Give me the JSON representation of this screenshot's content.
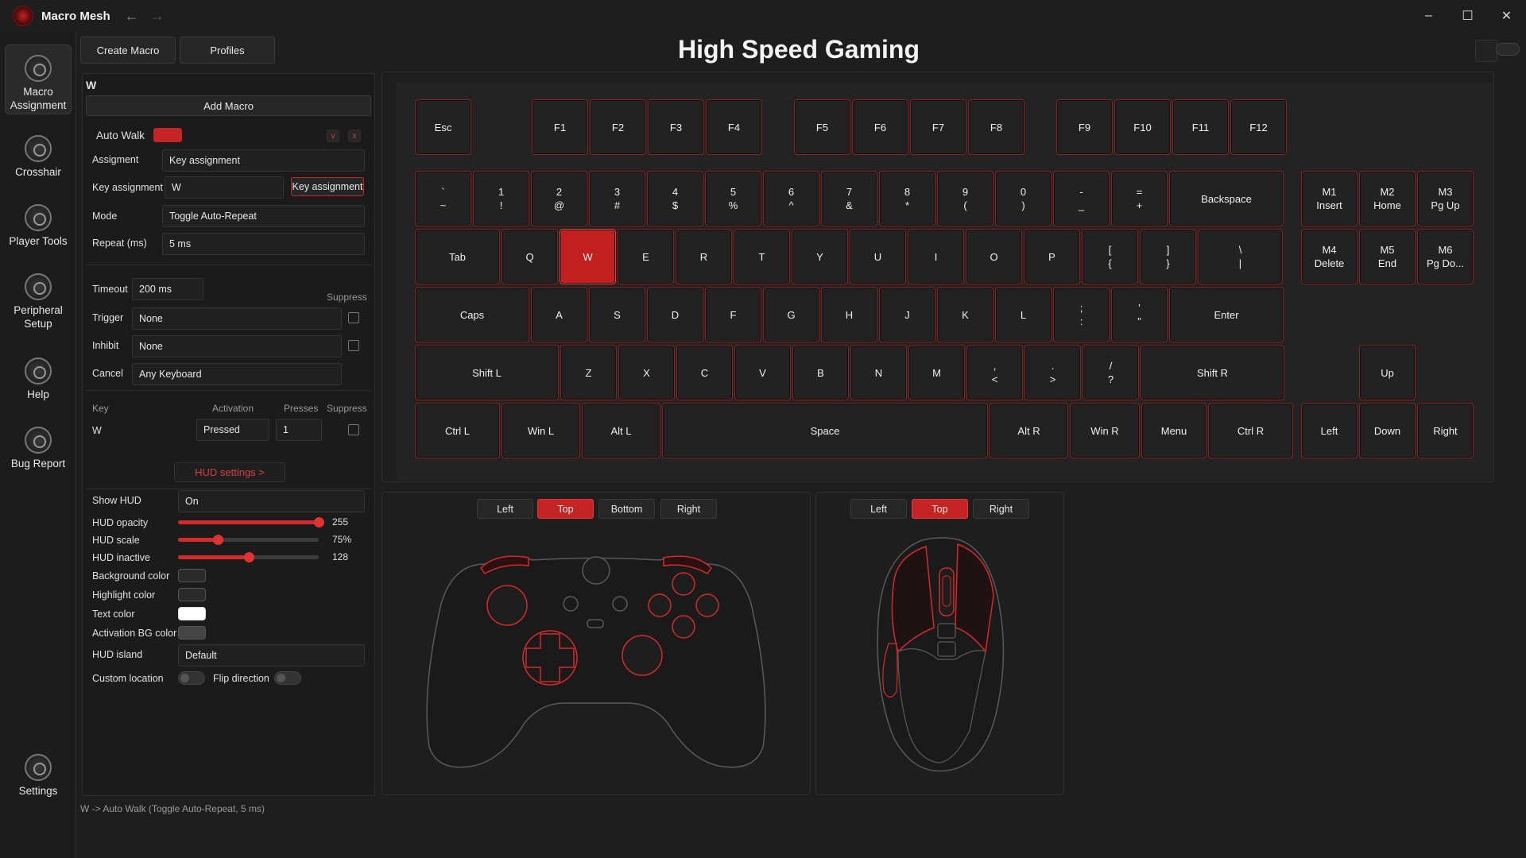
{
  "app": {
    "title": "Macro Mesh"
  },
  "colors": {
    "accent": "#c42424",
    "background": "#1e1e1e",
    "key_border": "#8c2323"
  },
  "sidebar": {
    "items": [
      {
        "label": "Macro Assignment",
        "icon": "keyboard-icon"
      },
      {
        "label": "Crosshair",
        "icon": "crosshair-icon"
      },
      {
        "label": "Player Tools",
        "icon": "tools-icon"
      },
      {
        "label": "Peripheral Setup",
        "icon": "gamepad-icon"
      },
      {
        "label": "Help",
        "icon": "help-icon"
      },
      {
        "label": "Bug Report",
        "icon": "bug-icon"
      },
      {
        "label": "Settings",
        "icon": "gear-icon"
      }
    ]
  },
  "tabs": {
    "create": "Create Macro",
    "profiles": "Profiles"
  },
  "panel": {
    "key_title": "W",
    "add_macro": "Add Macro",
    "macro_name": "Auto Walk",
    "chev": "v",
    "close": "x",
    "assignment_label": "Assigment",
    "assignment_value": "Key assignment",
    "key_assign_label": "Key assignment",
    "key_assign_value": "W",
    "key_assign_button": "Key assignment",
    "mode_label": "Mode",
    "mode_value": "Toggle Auto-Repeat",
    "repeat_label": "Repeat (ms)",
    "repeat_value": "5 ms",
    "timeout_label": "Timeout",
    "timeout_value": "200 ms",
    "suppress_header": "Suppress",
    "trigger_label": "Trigger",
    "trigger_value": "None",
    "inhibit_label": "Inhibit",
    "inhibit_value": "None",
    "cancel_label": "Cancel",
    "cancel_value": "Any Keyboard",
    "col_key": "Key",
    "col_activation": "Activation",
    "col_presses": "Presses",
    "col_suppress": "Suppress",
    "row_key": "W",
    "row_activation": "Pressed",
    "row_presses": "1",
    "hud_settings": "HUD settings  >",
    "show_hud_label": "Show HUD",
    "show_hud_value": "On",
    "opacity_label": "HUD opacity",
    "opacity_value": "255",
    "opacity_fraction": 1.0,
    "scale_label": "HUD scale",
    "scale_value": "75%",
    "scale_fraction": 0.28,
    "inactive_label": "HUD inactive",
    "inactive_value": "128",
    "inactive_fraction": 0.5,
    "bg_color_label": "Background color",
    "hl_color_label": "Highlight color",
    "text_color_label": "Text color",
    "act_bg_label": "Activation BG color",
    "island_label": "HUD island",
    "island_value": "Default",
    "custom_loc_label": "Custom location",
    "flip_label": "Flip direction"
  },
  "main": {
    "title": "High Speed Gaming",
    "status": "W -> Auto Walk (Toggle Auto-Repeat, 5 ms)"
  },
  "keyboard": {
    "fn": [
      "Esc",
      "F1",
      "F2",
      "F3",
      "F4",
      "F5",
      "F6",
      "F7",
      "F8",
      "F9",
      "F10",
      "F11",
      "F12"
    ],
    "num": [
      [
        "`",
        "~"
      ],
      [
        "1",
        "!"
      ],
      [
        "2",
        "@"
      ],
      [
        "3",
        "#"
      ],
      [
        "4",
        "$"
      ],
      [
        "5",
        "%"
      ],
      [
        "6",
        "^"
      ],
      [
        "7",
        "&"
      ],
      [
        "8",
        "*"
      ],
      [
        "9",
        "("
      ],
      [
        "0",
        ")"
      ],
      [
        "-",
        "_"
      ],
      [
        "=",
        "+"
      ],
      [
        "Backspace"
      ]
    ],
    "qwerty": [
      "Tab",
      "Q",
      "W",
      "E",
      "R",
      "T",
      "Y",
      "U",
      "I",
      "O",
      "P",
      [
        "[",
        "{"
      ],
      [
        "]",
        "}"
      ],
      [
        "\\",
        "|"
      ]
    ],
    "home": [
      "Caps",
      "A",
      "S",
      "D",
      "F",
      "G",
      "H",
      "J",
      "K",
      "L",
      [
        ";",
        ":"
      ],
      [
        "'",
        "\""
      ],
      "Enter"
    ],
    "shift": [
      "Shift L",
      "Z",
      "X",
      "C",
      "V",
      "B",
      "N",
      "M",
      [
        ",",
        "<"
      ],
      [
        ".",
        ">"
      ],
      [
        "/",
        "?"
      ],
      "Shift R"
    ],
    "bottom": [
      "Ctrl L",
      "Win L",
      "Alt L",
      "Space",
      "Alt R",
      "Win R",
      "Menu",
      "Ctrl R"
    ],
    "macro": [
      [
        "M1",
        "Insert"
      ],
      [
        "M2",
        "Home"
      ],
      [
        "M3",
        "Pg Up"
      ],
      [
        "M4",
        "Delete"
      ],
      [
        "M5",
        "End"
      ],
      [
        "M6",
        "Pg Do..."
      ]
    ],
    "arrows": [
      "Up",
      "Left",
      "Down",
      "Right"
    ],
    "active_key": "W"
  },
  "controller_views": [
    "Left",
    "Top",
    "Bottom",
    "Right"
  ],
  "controller_active": "Top",
  "mouse_views": [
    "Left",
    "Top",
    "Right"
  ],
  "mouse_active": "Top"
}
